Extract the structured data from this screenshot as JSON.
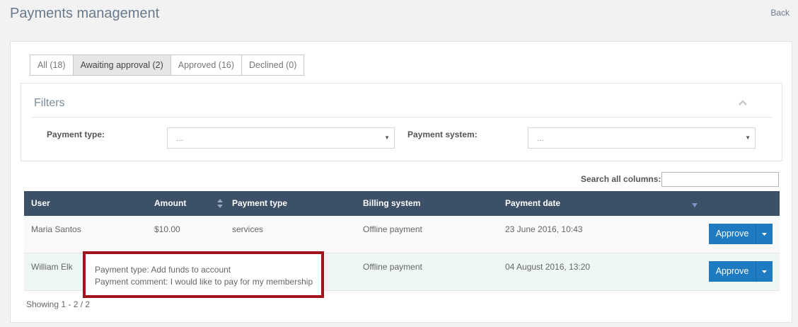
{
  "header": {
    "title": "Payments management",
    "back_label": "Back"
  },
  "tabs": [
    {
      "label": "All (18)",
      "active": false
    },
    {
      "label": "Awaiting approval (2)",
      "active": true
    },
    {
      "label": "Approved (16)",
      "active": false
    },
    {
      "label": "Declined (0)",
      "active": false
    }
  ],
  "filters": {
    "title": "Filters",
    "payment_type_label": "Payment type:",
    "payment_type_value": "...",
    "payment_system_label": "Payment system:",
    "payment_system_value": "..."
  },
  "search": {
    "label": "Search all columns:",
    "value": ""
  },
  "table": {
    "columns": [
      "User",
      "Amount",
      "Payment type",
      "Billing system",
      "Payment date"
    ],
    "rows": [
      {
        "user": "Maria Santos",
        "amount": "$10.00",
        "payment_type": "services",
        "billing_system": "Offline payment",
        "payment_date": "23 June 2016, 10:43",
        "action": "Approve"
      },
      {
        "user": "William Elk",
        "amount": "",
        "payment_type": "",
        "billing_system": "Offline payment",
        "payment_date": "04 August 2016, 13:20",
        "action": "Approve"
      }
    ]
  },
  "tooltip": {
    "line1": "Payment type: Add funds to account",
    "line2": "Payment comment: I would like to pay for my membership"
  },
  "footer": {
    "showing": "Showing 1 - 2 / 2"
  },
  "colors": {
    "header_bg": "#3c5068",
    "accent_button": "#1f7bc1",
    "highlight_border": "#a0141e"
  }
}
